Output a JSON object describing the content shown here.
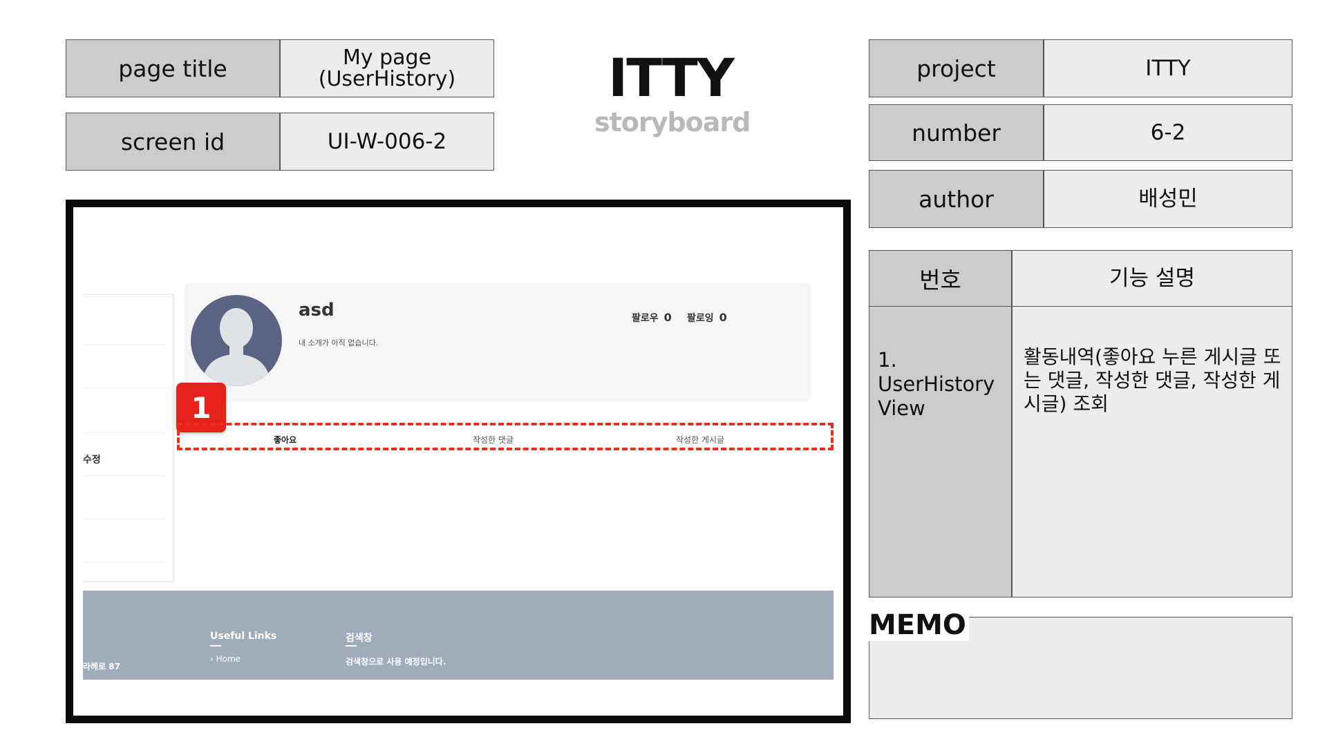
{
  "header_table": {
    "page_title_label": "page title",
    "page_title_value": "My page\n(UserHistory)",
    "screen_id_label": "screen id",
    "screen_id_value": "UI-W-006-2"
  },
  "logo": {
    "title": "ITTY",
    "subtitle": "storyboard"
  },
  "project_table": {
    "project_label": "project",
    "project_value": "ITTY",
    "number_label": "number",
    "number_value": "6-2",
    "author_label": "author",
    "author_value": "배성민"
  },
  "description_table": {
    "num_header": "번호",
    "desc_header": "기능 설명",
    "rows": [
      {
        "num": "1. UserHistory View",
        "desc": "활동내역(좋아요 누른 게시글 또는 댓글, 작성한 댓글, 작성한 게시글) 조회"
      }
    ]
  },
  "memo": {
    "title": "MEMO",
    "content": ""
  },
  "mockup": {
    "sidebar_item": "수정",
    "profile": {
      "username": "asd",
      "bio": "내 소개가 아직 없습니다.",
      "follower_label": "팔로우",
      "follower_count": "0",
      "following_label": "팔로잉",
      "following_count": "0"
    },
    "badge_number": "1",
    "tabs": [
      "좋아요",
      "작성한 댓글",
      "작성한 게시글"
    ],
    "footer": {
      "address": "라헤로 87",
      "useful_links_title": "Useful Links",
      "home_link": "Home",
      "search_title": "검색창",
      "search_text": "검색창으로 사용 예정입니다."
    }
  },
  "colors": {
    "label_bg": "#cccccc",
    "value_bg": "#ececec",
    "badge_red": "#e4211b",
    "avatar": "#5a6383",
    "footer": "#a0acbc"
  }
}
